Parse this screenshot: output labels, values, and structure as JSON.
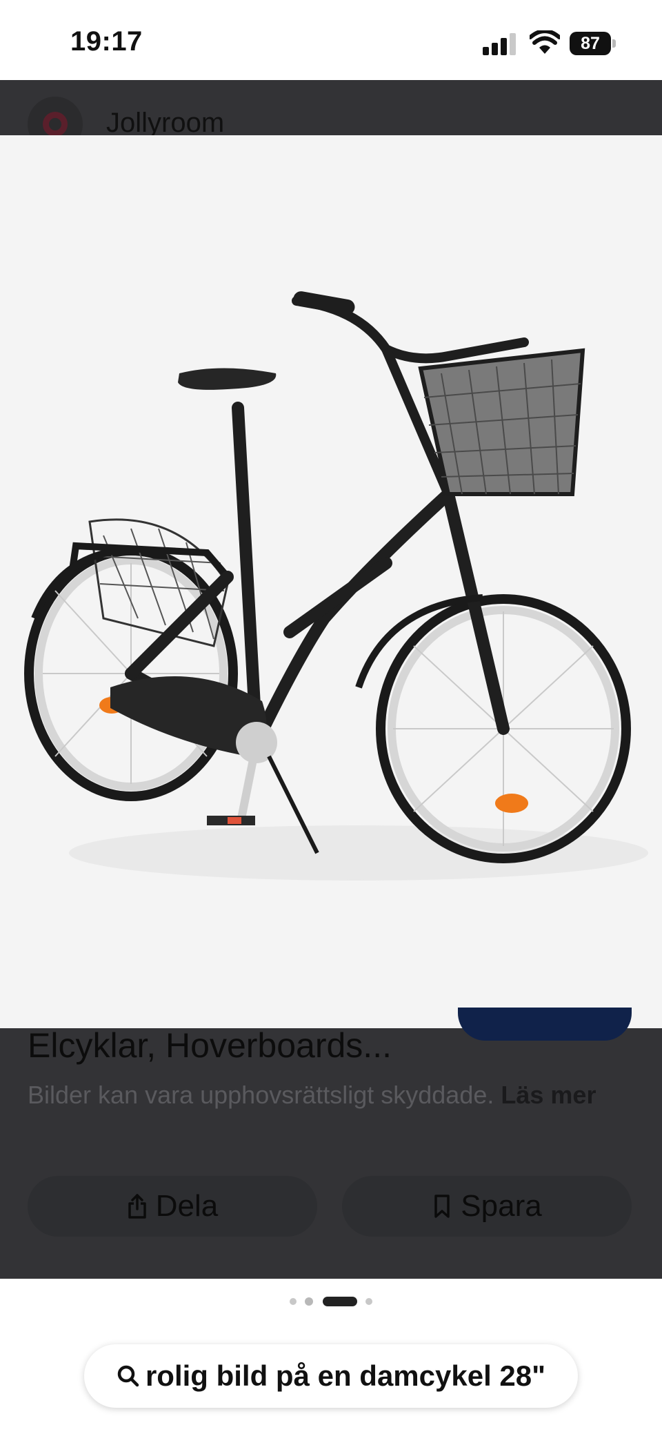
{
  "status_bar": {
    "time": "19:17",
    "battery_level": "87"
  },
  "source": {
    "name": "Jollyroom"
  },
  "image": {
    "subject": "bicycle-photo"
  },
  "result": {
    "title": "Elcyklar, Hoverboards...",
    "copyright_text": "Bilder kan vara upphovsrättsligt skyddade.",
    "read_more_label": "Läs mer"
  },
  "actions": {
    "share_label": "Dela",
    "save_label": "Spara"
  },
  "pager": {
    "count": 4,
    "active_index": 2
  },
  "search": {
    "query": "rolig bild på en damcykel 28\""
  },
  "colors": {
    "overlay": "#333336",
    "image_bg": "#f4f4f4",
    "button_bg": "#2d2e31",
    "accent_peek": "#10224a"
  }
}
